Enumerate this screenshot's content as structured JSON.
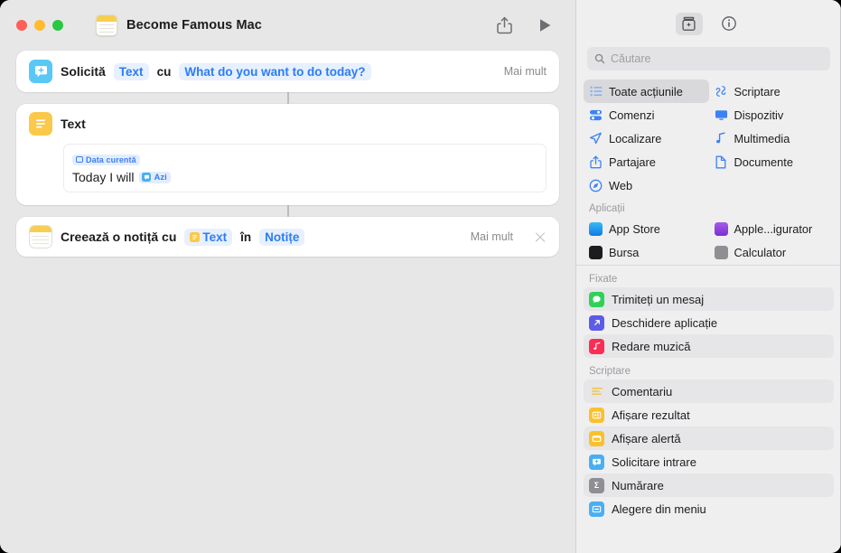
{
  "window": {
    "title": "Become Famous Mac",
    "app_icon": "notes-icon",
    "traffic_lights": [
      "close",
      "minimize",
      "zoom"
    ],
    "share_icon": "share-icon",
    "run_icon": "play-icon"
  },
  "workflow": {
    "actions": [
      {
        "icon": "ask-for-input-icon",
        "verb": "Solicită",
        "type_token": "Text",
        "conj": "cu",
        "prompt_token": "What do you want to do today?",
        "more_label": "Mai mult"
      },
      {
        "icon": "text-action-icon",
        "title": "Text",
        "field": {
          "top_token": "Data curentă",
          "text": "Today I will",
          "inline_token": "Azi"
        }
      },
      {
        "icon": "notes-app-icon",
        "verb": "Creează o notiță cu",
        "input_token": "Text",
        "conj": "în",
        "target_token": "Notițe",
        "more_label": "Mai mult",
        "close_label": "×"
      }
    ]
  },
  "sidebar": {
    "toolbar": [
      {
        "name": "action-library-button",
        "icon": "box-sparkle-icon",
        "active": true
      },
      {
        "name": "info-button",
        "icon": "info-circle-icon",
        "active": false
      }
    ],
    "search": {
      "placeholder": "Căutare",
      "value": "",
      "icon": "search-icon"
    },
    "categories": [
      {
        "label": "Toate acțiunile",
        "icon": "list-bullet-icon",
        "selected": true
      },
      {
        "label": "Scriptare",
        "icon": "scripting-icon",
        "selected": false
      },
      {
        "label": "Comenzi",
        "icon": "shortcuts-toggle-icon",
        "selected": false
      },
      {
        "label": "Dispozitiv",
        "icon": "display-icon",
        "selected": false
      },
      {
        "label": "Localizare",
        "icon": "location-arrow-icon",
        "selected": false
      },
      {
        "label": "Multimedia",
        "icon": "music-note-icon",
        "selected": false
      },
      {
        "label": "Partajare",
        "icon": "share-icon",
        "selected": false
      },
      {
        "label": "Documente",
        "icon": "document-icon",
        "selected": false
      },
      {
        "label": "Web",
        "icon": "safari-compass-icon",
        "selected": false
      }
    ],
    "apps_header": "Aplicații",
    "apps": [
      {
        "label": "App Store",
        "icon": "app-store-icon",
        "color": "#1a9bf0"
      },
      {
        "label": "Apple...igurator",
        "icon": "apple-configurator-icon",
        "color": "#8a3fd1"
      },
      {
        "label": "Bursa",
        "icon": "stocks-icon",
        "color": "#1c1c1e"
      },
      {
        "label": "Calculator",
        "icon": "calculator-icon",
        "color": "#6d6d72"
      }
    ],
    "pinned_header": "Fixate",
    "pinned": [
      {
        "label": "Trimiteți un mesaj",
        "icon": "messages-icon",
        "color": "#30d158",
        "alt": true
      },
      {
        "label": "Deschidere aplicație",
        "icon": "open-app-icon",
        "color": "#5e5ce6",
        "alt": false
      },
      {
        "label": "Redare muzică",
        "icon": "music-icon",
        "color": "#fa2d55",
        "alt": true
      }
    ],
    "scripting_header": "Scriptare",
    "scripting": [
      {
        "label": "Comentariu",
        "icon": "comment-icon",
        "color": "#fbc94a",
        "alt": true
      },
      {
        "label": "Afișare rezultat",
        "icon": "show-result-icon",
        "color": "#fbc02d",
        "alt": false
      },
      {
        "label": "Afișare alertă",
        "icon": "show-alert-icon",
        "color": "#fbc02d",
        "alt": true
      },
      {
        "label": "Solicitare intrare",
        "icon": "ask-input-icon",
        "color": "#4aaff0",
        "alt": false
      },
      {
        "label": "Numărare",
        "icon": "count-sigma-icon",
        "color": "#8e8e93",
        "alt": true
      },
      {
        "label": "Alegere din meniu",
        "icon": "choose-menu-icon",
        "color": "#4aaff0",
        "alt": false
      }
    ]
  },
  "colors": {
    "accent_blue": "#2b7cf6",
    "token_bg": "#e7f0fe",
    "window_bg": "#e8e7e7",
    "sidebar_bg": "#efeff0",
    "card_bg": "#ffffff"
  }
}
